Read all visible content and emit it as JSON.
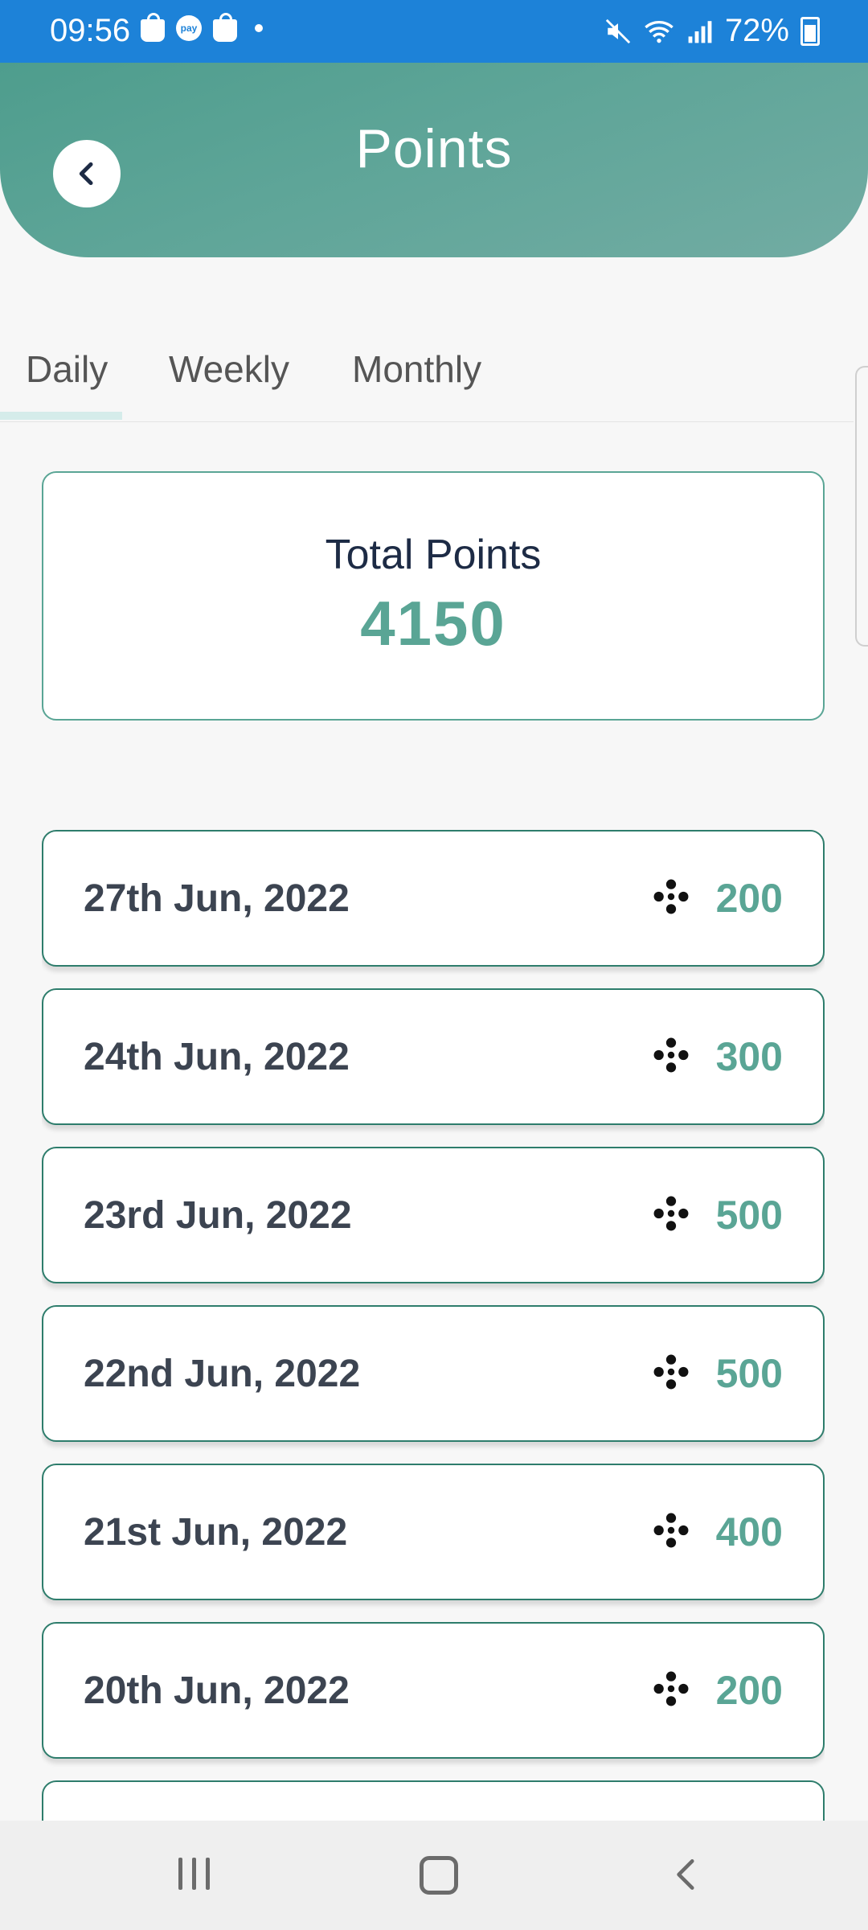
{
  "status_bar": {
    "time": "09:56",
    "battery": "72%",
    "icons": [
      "shopping-bag-icon",
      "pay-icon",
      "shopping-bag-icon",
      "dot-icon",
      "mute-icon",
      "wifi-icon",
      "signal-icon",
      "battery-icon"
    ]
  },
  "header": {
    "title": "Points",
    "back_icon": "chevron-left-icon"
  },
  "tabs": [
    {
      "label": "Daily",
      "selected": true
    },
    {
      "label": "Weekly",
      "selected": false
    },
    {
      "label": "Monthly",
      "selected": false
    }
  ],
  "total": {
    "label": "Total Points",
    "value": "4150"
  },
  "entries": [
    {
      "date": "27th Jun, 2022",
      "points": "200"
    },
    {
      "date": "24th Jun, 2022",
      "points": "300"
    },
    {
      "date": "23rd Jun, 2022",
      "points": "500"
    },
    {
      "date": "22nd Jun, 2022",
      "points": "500"
    },
    {
      "date": "21st Jun, 2022",
      "points": "400"
    },
    {
      "date": "20th Jun, 2022",
      "points": "200"
    }
  ],
  "colors": {
    "status_bar": "#1d82d8",
    "accent": "#5aa595",
    "card_border": "#2e7d6c",
    "date_text": "#3c4451"
  },
  "nav_bar": {
    "icons": [
      "recents-icon",
      "home-icon",
      "back-icon"
    ]
  }
}
